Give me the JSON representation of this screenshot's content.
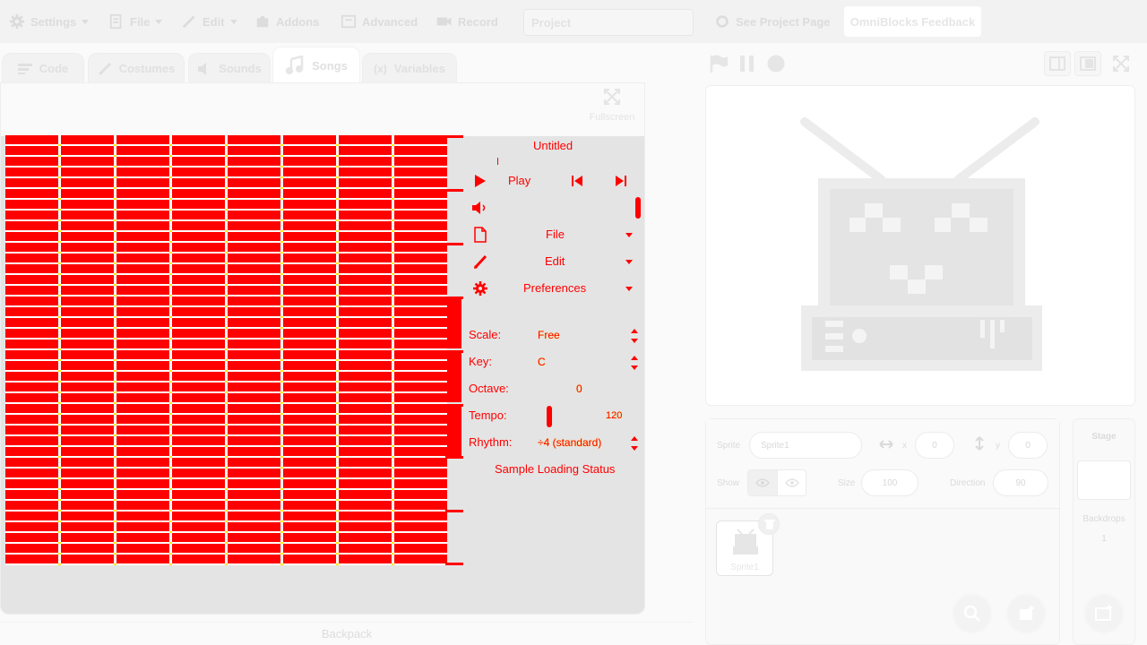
{
  "menu": {
    "settings": "Settings",
    "file": "File",
    "edit": "Edit",
    "addons": "Addons",
    "advanced": "Advanced",
    "record": "Record",
    "project_title": "Project",
    "see_project_page": "See Project Page",
    "feedback": "OmniBlocks Feedback"
  },
  "tabs": [
    "Code",
    "Costumes",
    "Sounds",
    "Songs",
    "Variables"
  ],
  "active_tab": "Songs",
  "editor": {
    "fullscreen_label": "Fullscreen",
    "song_title": "Untitled",
    "play_label": "Play",
    "file_menu": "File",
    "edit_menu": "Edit",
    "preferences_menu": "Preferences",
    "scale_label": "Scale:",
    "scale_value": "Free",
    "key_label": "Key:",
    "key_value": "C",
    "octave_label": "Octave:",
    "octave_value": "0",
    "tempo_label": "Tempo:",
    "tempo_value": "120",
    "rhythm_label": "Rhythm:",
    "rhythm_value": "÷4 (standard)",
    "sample_status": "Sample Loading Status"
  },
  "backpack_label": "Backpack",
  "sprite_info": {
    "sprite_label": "Sprite",
    "sprite_name": "Sprite1",
    "x_label": "x",
    "x_value": "0",
    "y_label": "y",
    "y_value": "0",
    "show_label": "Show",
    "size_label": "Size",
    "size_value": "100",
    "direction_label": "Direction",
    "direction_value": "90"
  },
  "sprites": [
    {
      "name": "Sprite1"
    }
  ],
  "stage_pane": {
    "title": "Stage",
    "backdrops_label": "Backdrops",
    "backdrops_count": "1"
  },
  "colors": {
    "note_fill": "#ff0000",
    "beat_marker": "#ffea00",
    "panel_bg": "#e4e4e4"
  }
}
